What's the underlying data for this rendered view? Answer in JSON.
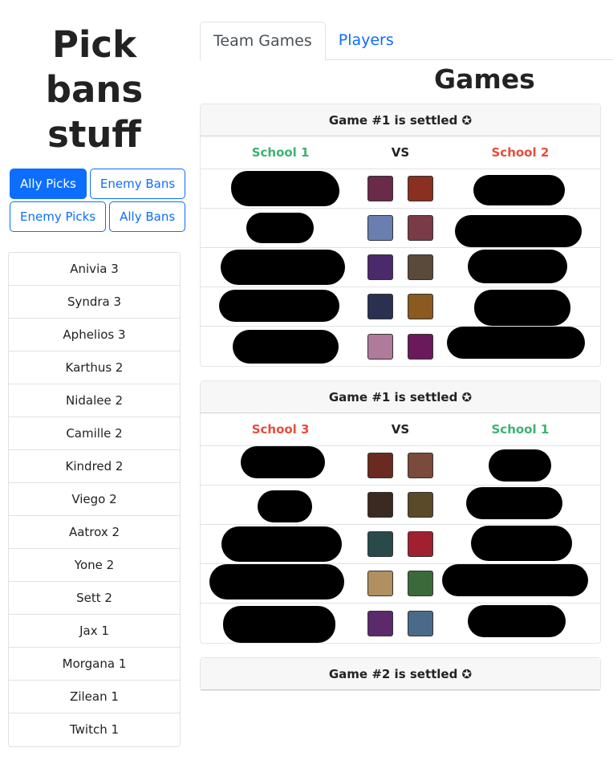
{
  "sidebar": {
    "title": "Pick bans stuff",
    "buttons": [
      "Ally Picks",
      "Enemy Bans",
      "Enemy Picks",
      "Ally Bans"
    ],
    "champions": [
      "Anivia 3",
      "Syndra 3",
      "Aphelios 3",
      "Karthus 2",
      "Nidalee 2",
      "Camille 2",
      "Kindred 2",
      "Viego 2",
      "Aatrox 2",
      "Yone 2",
      "Sett 2",
      "Jax 1",
      "Morgana 1",
      "Zilean 1",
      "Twitch 1"
    ]
  },
  "tabs": [
    "Team Games",
    "Players"
  ],
  "main": {
    "title": "Games"
  },
  "games": [
    {
      "header": "Game #1 is settled ✪",
      "team1": "School 1",
      "team1_color": "#3cb371",
      "vs": "VS",
      "team2": "School 2",
      "team2_color": "#e74c3c",
      "icons": [
        [
          "fiora-icon",
          "wukong-icon"
        ],
        [
          "kindred-icon",
          "vayne-icon"
        ],
        [
          "syndra-icon",
          "garen-icon"
        ],
        [
          "kalista-icon",
          "nidalee-icon"
        ],
        [
          "lulu-icon",
          "evelynn-icon"
        ]
      ],
      "icon_colors": [
        [
          "#6a2a4a",
          "#8a3020"
        ],
        [
          "#6a7fb0",
          "#7a3a48"
        ],
        [
          "#4a2a6a",
          "#5a4a3a"
        ],
        [
          "#2a3050",
          "#8a5a20"
        ],
        [
          "#b07a9a",
          "#6a1a5a"
        ]
      ]
    },
    {
      "header": "Game #1 is settled ✪",
      "team1": "School 3",
      "team1_color": "#e74c3c",
      "vs": "VS",
      "team2": "School 1",
      "team2_color": "#3cb371",
      "icons": [
        [
          "darius-icon",
          "pantheon-icon"
        ],
        [
          "draven-icon",
          "qiyana-icon"
        ],
        [
          "akali-icon",
          "aatrox-icon"
        ],
        [
          "ezreal-icon",
          "rengar-icon"
        ],
        [
          "morgana-icon",
          "zilean-icon"
        ]
      ],
      "icon_colors": [
        [
          "#6a2a20",
          "#7a4a3a"
        ],
        [
          "#3a2a20",
          "#5a4a2a"
        ],
        [
          "#2a4a4a",
          "#a02030"
        ],
        [
          "#b09060",
          "#3a6a3a"
        ],
        [
          "#5a2a6a",
          "#4a6a8a"
        ]
      ]
    },
    {
      "header": "Game #2 is settled ✪"
    }
  ]
}
